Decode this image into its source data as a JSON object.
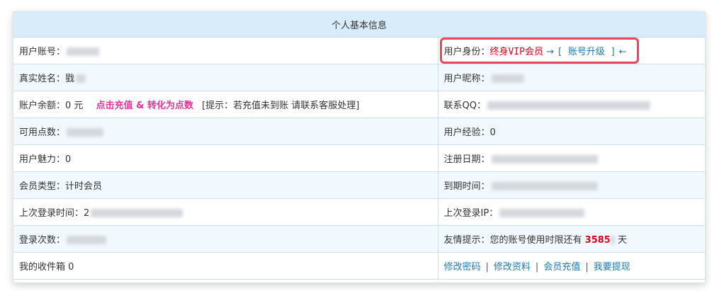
{
  "header": {
    "title": "个人基本信息"
  },
  "rows": [
    {
      "left": {
        "label": "用户账号："
      },
      "right": {
        "label": "用户身份：",
        "identity": "终身VIP会员",
        "arrow_right": "→",
        "upgrade": "[ 账号升级 ]",
        "arrow_left": "←"
      }
    },
    {
      "left": {
        "label": "真实姓名：",
        "visible_prefix": "戥"
      },
      "right": {
        "label": "用户昵称："
      }
    },
    {
      "left": {
        "label": "账户余额：",
        "value": "0 元",
        "recharge_link": "点击充值 & 转化为点数",
        "hint": "[提示：若充值未到账 请联系客服处理]"
      },
      "right": {
        "label": "联系QQ："
      }
    },
    {
      "left": {
        "label": "可用点数："
      },
      "right": {
        "label": "用户经验：",
        "value": "0"
      }
    },
    {
      "left": {
        "label": "用户魅力：",
        "value": "0"
      },
      "right": {
        "label": "注册日期："
      }
    },
    {
      "left": {
        "label": "会员类型：",
        "value": "计时会员"
      },
      "right": {
        "label": "到期时间："
      }
    },
    {
      "left": {
        "label": "上次登录时间：",
        "visible_prefix": "2"
      },
      "right": {
        "label": "上次登录IP："
      }
    },
    {
      "left": {
        "label": "登录次数："
      },
      "right": {
        "label": "友情提示：您的账号使用时限还有",
        "days": "3585",
        "unit": "天"
      }
    },
    {
      "left": {
        "label": "我的收件箱",
        "value": "0"
      },
      "right": {
        "links": [
          "修改密码",
          "修改资料",
          "会员充值",
          "我要提现"
        ],
        "separator": "|"
      }
    }
  ],
  "colors": {
    "accent_red": "#d9001b",
    "link_blue": "#1a7ab5",
    "pink": "#e6339a",
    "header_bg": "#d8ecfa",
    "highlight_border": "#e8475f"
  }
}
